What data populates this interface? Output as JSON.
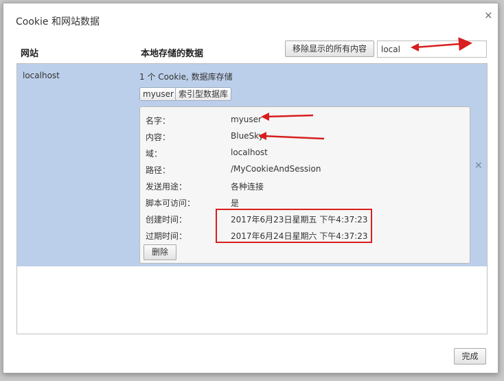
{
  "dialog": {
    "title": "Cookie 和网站数据",
    "close_glyph": "×"
  },
  "header": {
    "site_column": "网站",
    "data_column": "本地存储的数据",
    "remove_all_label": "移除显示的所有内容",
    "search_value": "local"
  },
  "row": {
    "site": "localhost",
    "summary": "1 个 Cookie, 数据库存储",
    "chips": [
      "myuser",
      "索引型数据库"
    ],
    "close_glyph": "×"
  },
  "cookie": {
    "name": {
      "label": "名字：",
      "value": "myuser"
    },
    "content": {
      "label": "内容：",
      "value": "BlueSky"
    },
    "domain": {
      "label": "域：",
      "value": "localhost"
    },
    "path": {
      "label": "路径：",
      "value": "/MyCookieAndSession"
    },
    "send_for": {
      "label": "发送用途：",
      "value": "各种连接"
    },
    "script_access": {
      "label": "脚本可访问：",
      "value": "是"
    },
    "created": {
      "label": "创建时间：",
      "value": "2017年6月23日星期五 下午4:37:23"
    },
    "expires": {
      "label": "过期时间：",
      "value": "2017年6月24日星期六 下午4:37:23"
    },
    "delete_label": "删除"
  },
  "footer": {
    "done_label": "完成"
  },
  "colors": {
    "selection": "#bccfea",
    "annotation": "#d81e1e"
  }
}
